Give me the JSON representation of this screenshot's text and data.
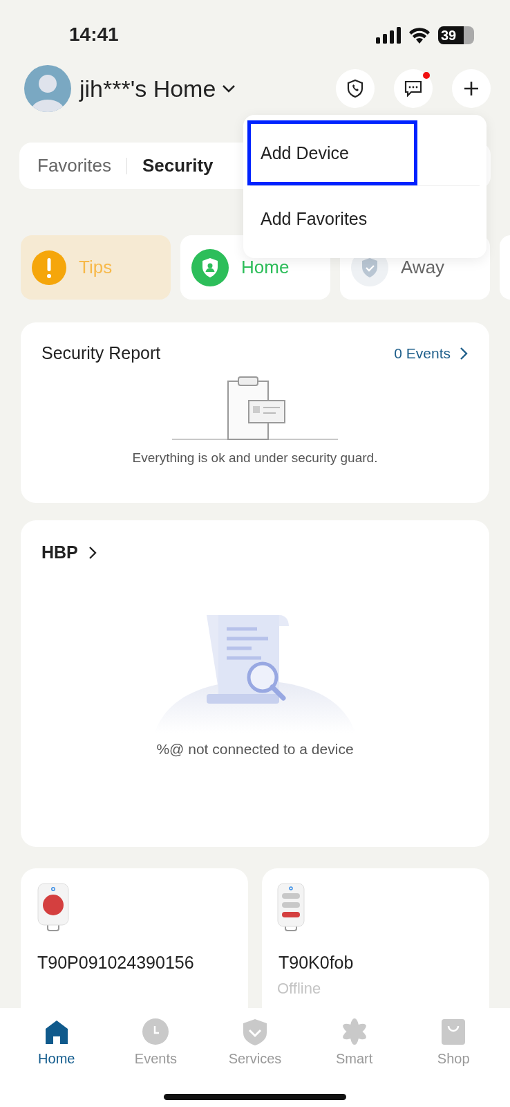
{
  "status_bar": {
    "time": "14:41",
    "battery": "39"
  },
  "header": {
    "title": "jih***'s Home",
    "messages_unread": true
  },
  "segments": [
    {
      "label": "Favorites",
      "selected": false
    },
    {
      "label": "Security",
      "selected": true
    }
  ],
  "add_menu": {
    "items": [
      {
        "label": "Add Device",
        "highlighted": true
      },
      {
        "label": "Add Favorites",
        "highlighted": false
      }
    ]
  },
  "tips": {
    "label": "Tips"
  },
  "modes": [
    {
      "label": "Home",
      "selected": true
    },
    {
      "label": "Away",
      "selected": false
    }
  ],
  "security_report": {
    "title": "Security Report",
    "events_link": "0 Events",
    "message": "Everything is ok and under security guard."
  },
  "hbp": {
    "title": "HBP",
    "message": "%@ not connected to a device"
  },
  "devices": [
    {
      "kind": "button",
      "name": "T90P091024390156"
    },
    {
      "kind": "keyfob",
      "name": "T90K0fob",
      "status": "Offline"
    }
  ],
  "nav": [
    {
      "label": "Home",
      "kind": "home",
      "selected": true
    },
    {
      "label": "Events",
      "kind": "events",
      "selected": false
    },
    {
      "label": "Services",
      "kind": "services",
      "selected": false
    },
    {
      "label": "Smart",
      "kind": "smart",
      "selected": false
    },
    {
      "label": "Shop",
      "kind": "shop",
      "selected": false
    }
  ]
}
